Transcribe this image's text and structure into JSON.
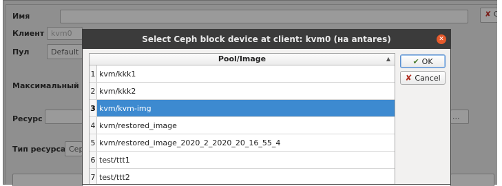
{
  "form": {
    "name_label": "Имя",
    "client_label": "Клиент",
    "client_value": "kvm0",
    "pool_label": "Пул",
    "pool_value": "Default",
    "max_label": "Максимальный о",
    "resource_label": "Ресурс",
    "resource_browse": "...",
    "resource_type_label": "Тип ресурса",
    "resource_type_value": "Сер",
    "close_btn_label": "С"
  },
  "dialog": {
    "title": "Select Ceph block device at client: kvm0 (на antares)",
    "column_header": "Pool/Image",
    "ok_label": "OK",
    "cancel_label": "Cancel",
    "rows": [
      {
        "num": "1",
        "text": "kvm/kkk1"
      },
      {
        "num": "2",
        "text": "kvm/kkk2"
      },
      {
        "num": "3",
        "text": "kvm/kvm-img"
      },
      {
        "num": "4",
        "text": "kvm/restored_image"
      },
      {
        "num": "5",
        "text": "kvm/restored_image_2020_2_2020_20_16_55_4"
      },
      {
        "num": "6",
        "text": "test/ttt1"
      },
      {
        "num": "7",
        "text": "test/ttt2"
      }
    ],
    "selected_row": 3
  },
  "icons": {
    "ok": "check-icon",
    "cancel": "x-icon",
    "close": "close-icon",
    "sort": "sort-asc-icon"
  },
  "colors": {
    "selection": "#3d8ad0",
    "titlebar": "#3b3b3b",
    "close_circle": "#e65a2c"
  }
}
